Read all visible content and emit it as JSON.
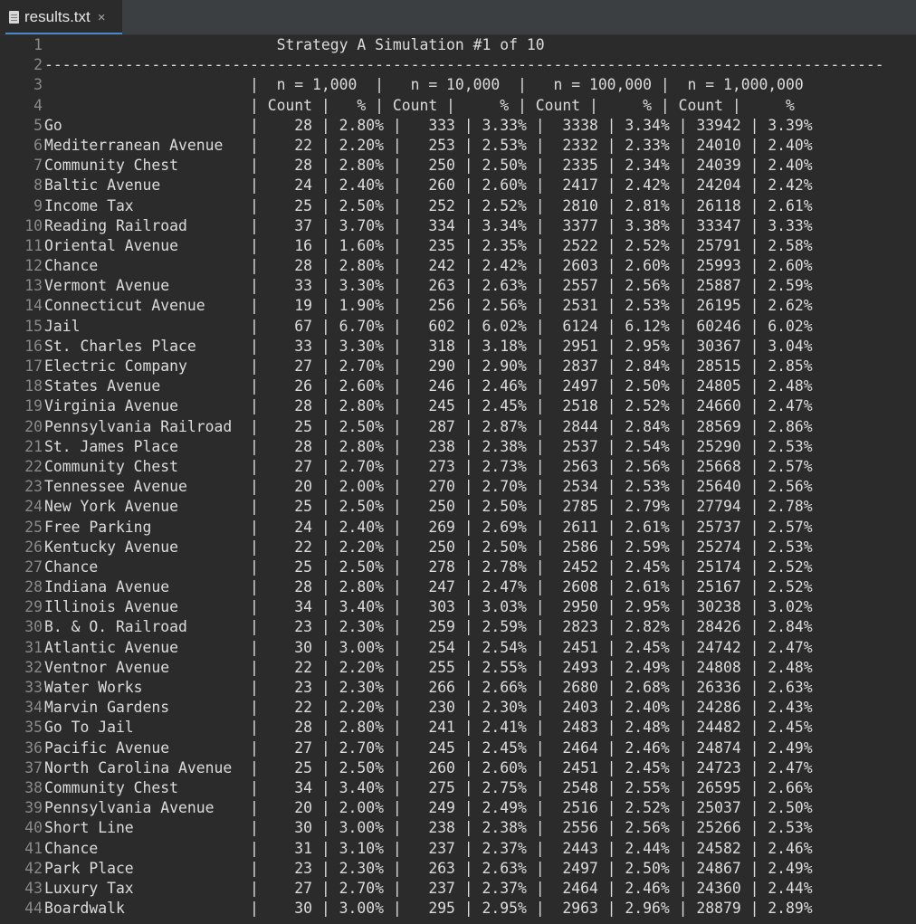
{
  "tab": {
    "filename": "results.txt",
    "close_symbol": "×"
  },
  "lines": [
    "                          Strategy A Simulation #1 of 10",
    "----------------------------------------------------------------------------------------------",
    "                       |  n = 1,000  |   n = 10,000  |   n = 100,000 |  n = 1,000,000",
    "                       | Count |   % | Count |     % | Count |     % | Count |     %",
    "Go                     |    28 | 2.80% |   333 | 3.33% |  3338 | 3.34% | 33942 | 3.39%",
    "Mediterranean Avenue   |    22 | 2.20% |   253 | 2.53% |  2332 | 2.33% | 24010 | 2.40%",
    "Community Chest        |    28 | 2.80% |   250 | 2.50% |  2335 | 2.34% | 24039 | 2.40%",
    "Baltic Avenue          |    24 | 2.40% |   260 | 2.60% |  2417 | 2.42% | 24204 | 2.42%",
    "Income Tax             |    25 | 2.50% |   252 | 2.52% |  2810 | 2.81% | 26118 | 2.61%",
    "Reading Railroad       |    37 | 3.70% |   334 | 3.34% |  3377 | 3.38% | 33347 | 3.33%",
    "Oriental Avenue        |    16 | 1.60% |   235 | 2.35% |  2522 | 2.52% | 25791 | 2.58%",
    "Chance                 |    28 | 2.80% |   242 | 2.42% |  2603 | 2.60% | 25993 | 2.60%",
    "Vermont Avenue         |    33 | 3.30% |   263 | 2.63% |  2557 | 2.56% | 25887 | 2.59%",
    "Connecticut Avenue     |    19 | 1.90% |   256 | 2.56% |  2531 | 2.53% | 26195 | 2.62%",
    "Jail                   |    67 | 6.70% |   602 | 6.02% |  6124 | 6.12% | 60246 | 6.02%",
    "St. Charles Place      |    33 | 3.30% |   318 | 3.18% |  2951 | 2.95% | 30367 | 3.04%",
    "Electric Company       |    27 | 2.70% |   290 | 2.90% |  2837 | 2.84% | 28515 | 2.85%",
    "States Avenue          |    26 | 2.60% |   246 | 2.46% |  2497 | 2.50% | 24805 | 2.48%",
    "Virginia Avenue        |    28 | 2.80% |   245 | 2.45% |  2518 | 2.52% | 24660 | 2.47%",
    "Pennsylvania Railroad  |    25 | 2.50% |   287 | 2.87% |  2844 | 2.84% | 28569 | 2.86%",
    "St. James Place        |    28 | 2.80% |   238 | 2.38% |  2537 | 2.54% | 25290 | 2.53%",
    "Community Chest        |    27 | 2.70% |   273 | 2.73% |  2563 | 2.56% | 25668 | 2.57%",
    "Tennessee Avenue       |    20 | 2.00% |   270 | 2.70% |  2534 | 2.53% | 25640 | 2.56%",
    "New York Avenue        |    25 | 2.50% |   250 | 2.50% |  2785 | 2.79% | 27794 | 2.78%",
    "Free Parking           |    24 | 2.40% |   269 | 2.69% |  2611 | 2.61% | 25737 | 2.57%",
    "Kentucky Avenue        |    22 | 2.20% |   250 | 2.50% |  2586 | 2.59% | 25274 | 2.53%",
    "Chance                 |    25 | 2.50% |   278 | 2.78% |  2452 | 2.45% | 25174 | 2.52%",
    "Indiana Avenue         |    28 | 2.80% |   247 | 2.47% |  2608 | 2.61% | 25167 | 2.52%",
    "Illinois Avenue        |    34 | 3.40% |   303 | 3.03% |  2950 | 2.95% | 30238 | 3.02%",
    "B. & O. Railroad       |    23 | 2.30% |   259 | 2.59% |  2823 | 2.82% | 28426 | 2.84%",
    "Atlantic Avenue        |    30 | 3.00% |   254 | 2.54% |  2451 | 2.45% | 24742 | 2.47%",
    "Ventnor Avenue         |    22 | 2.20% |   255 | 2.55% |  2493 | 2.49% | 24808 | 2.48%",
    "Water Works            |    23 | 2.30% |   266 | 2.66% |  2680 | 2.68% | 26336 | 2.63%",
    "Marvin Gardens         |    22 | 2.20% |   230 | 2.30% |  2403 | 2.40% | 24286 | 2.43%",
    "Go To Jail             |    28 | 2.80% |   241 | 2.41% |  2483 | 2.48% | 24482 | 2.45%",
    "Pacific Avenue         |    27 | 2.70% |   245 | 2.45% |  2464 | 2.46% | 24874 | 2.49%",
    "North Carolina Avenue  |    25 | 2.50% |   260 | 2.60% |  2451 | 2.45% | 24723 | 2.47%",
    "Community Chest        |    34 | 3.40% |   275 | 2.75% |  2548 | 2.55% | 26595 | 2.66%",
    "Pennsylvania Avenue    |    20 | 2.00% |   249 | 2.49% |  2516 | 2.52% | 25037 | 2.50%",
    "Short Line             |    30 | 3.00% |   238 | 2.38% |  2556 | 2.56% | 25266 | 2.53%",
    "Chance                 |    31 | 3.10% |   237 | 2.37% |  2443 | 2.44% | 24582 | 2.46%",
    "Park Place             |    23 | 2.30% |   263 | 2.63% |  2497 | 2.50% | 24867 | 2.49%",
    "Luxury Tax             |    27 | 2.70% |   237 | 2.37% |  2464 | 2.46% | 24360 | 2.44%",
    "Boardwalk              |    30 | 3.00% |   295 | 2.95% |  2963 | 2.96% | 28879 | 2.89%"
  ]
}
